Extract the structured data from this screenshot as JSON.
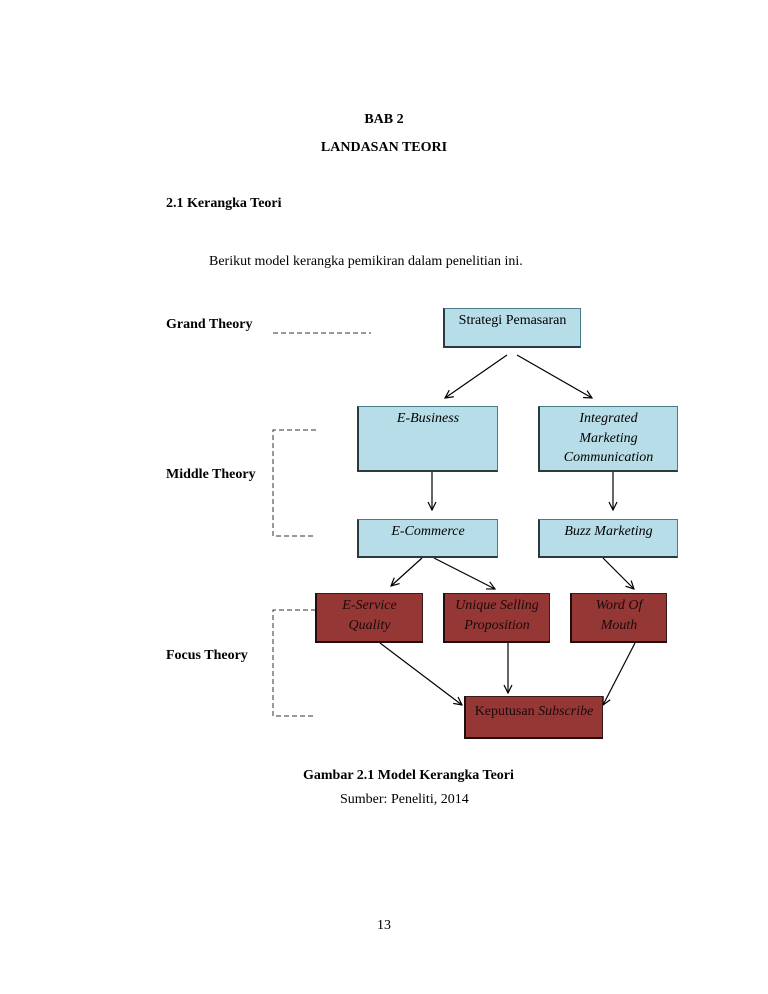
{
  "chapter": {
    "number": "BAB 2",
    "title": "LANDASAN TEORI"
  },
  "section": {
    "heading": "2.1 Kerangka Teori",
    "intro": "Berikut model kerangka pemikiran dalam penelitian ini."
  },
  "diagram": {
    "levels": {
      "grand": "Grand Theory",
      "middle": "Middle Theory",
      "focus": "Focus Theory"
    },
    "nodes": {
      "strategi": "Strategi Pemasaran",
      "ebusiness": "E-Business",
      "imc_line1": "Integrated",
      "imc_line2": "Marketing",
      "imc_line3": "Communication",
      "ecommerce": "E-Commerce",
      "buzz": "Buzz Marketing",
      "esq_line1": "E-Service",
      "esq_line2": "Quality",
      "usp_line1": "Unique Selling",
      "usp_line2": "Proposition",
      "wom_line1": "Word Of",
      "wom_line2": "Mouth",
      "decision_plain": "Keputusan ",
      "decision_italic": "Subscribe"
    },
    "edges": [
      [
        "Strategi Pemasaran",
        "E-Business"
      ],
      [
        "Strategi Pemasaran",
        "Integrated Marketing Communication"
      ],
      [
        "E-Business",
        "E-Commerce"
      ],
      [
        "Integrated Marketing Communication",
        "Buzz Marketing"
      ],
      [
        "E-Commerce",
        "E-Service Quality"
      ],
      [
        "E-Commerce",
        "Unique Selling Proposition"
      ],
      [
        "Buzz Marketing",
        "Word Of Mouth"
      ],
      [
        "E-Service Quality",
        "Keputusan Subscribe"
      ],
      [
        "Unique Selling Proposition",
        "Keputusan Subscribe"
      ],
      [
        "Word Of Mouth",
        "Keputusan Subscribe"
      ]
    ],
    "colors": {
      "theory_fill": "#b7dde8",
      "focus_fill": "#953735"
    }
  },
  "figure": {
    "caption": "Gambar 2.1 Model Kerangka Teori",
    "source": "Sumber: Peneliti, 2014"
  },
  "page_number": "13"
}
